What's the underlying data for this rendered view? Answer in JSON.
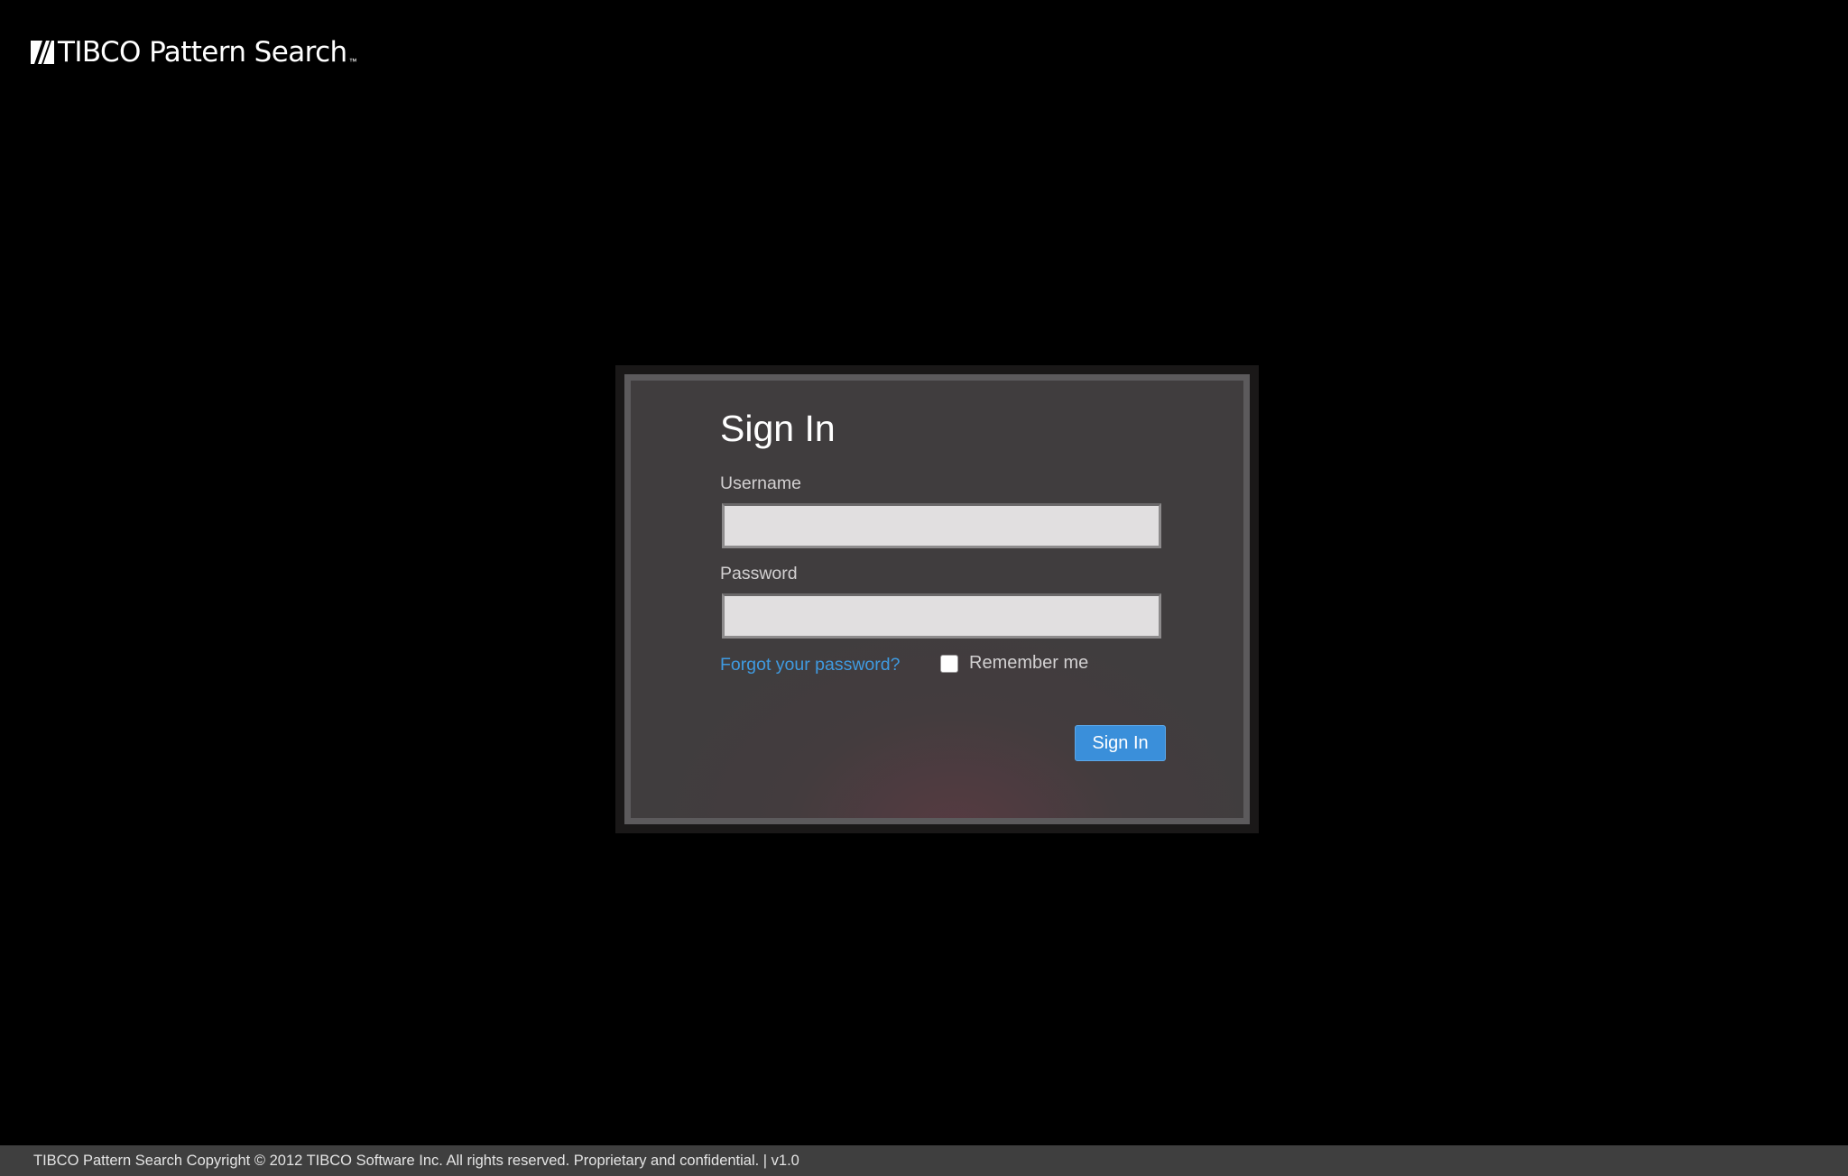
{
  "header": {
    "logo_text": "TIBCO Pattern Search",
    "logo_trademark": "™"
  },
  "signin": {
    "title": "Sign In",
    "username_label": "Username",
    "username_value": "",
    "password_label": "Password",
    "password_value": "",
    "forgot_password_link": "Forgot your password?",
    "remember_me_label": "Remember me",
    "remember_me_checked": false,
    "submit_label": "Sign In"
  },
  "footer": {
    "text": "TIBCO Pattern Search Copyright © 2012 TIBCO Software Inc. All rights reserved. Proprietary and confidential. | v1.0"
  },
  "colors": {
    "background": "#000000",
    "panel": "#403d3e",
    "link": "#3f9ae0",
    "button": "#3a8fda",
    "footer": "#3f3f3f"
  }
}
